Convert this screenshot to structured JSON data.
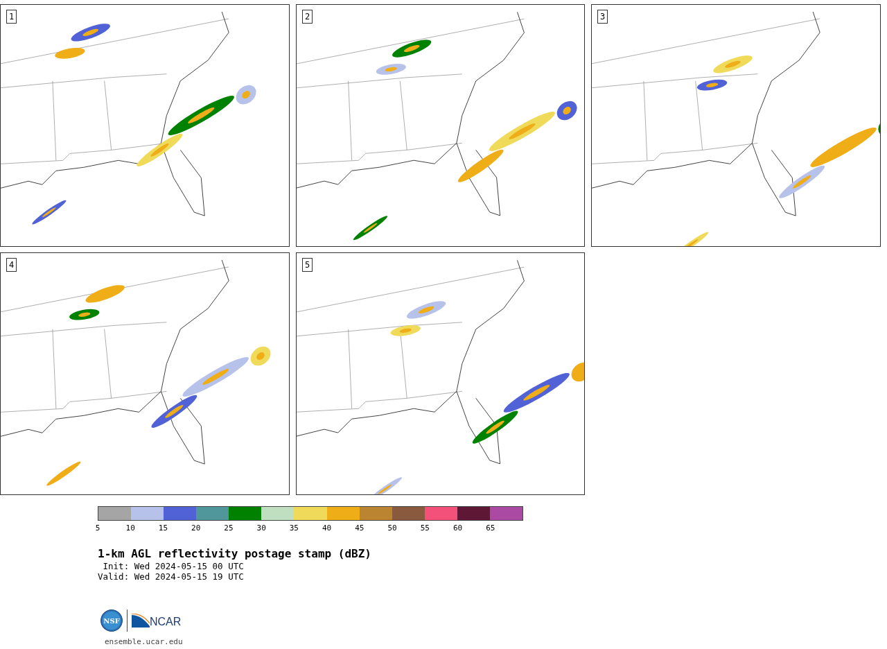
{
  "panels": [
    {
      "label": "1"
    },
    {
      "label": "2"
    },
    {
      "label": "3"
    },
    {
      "label": "4"
    },
    {
      "label": "5"
    }
  ],
  "colorbar": {
    "bins": [
      {
        "color": "#a5a5a5"
      },
      {
        "color": "#b7c2ea"
      },
      {
        "color": "#5062d5"
      },
      {
        "color": "#4f979b"
      },
      {
        "color": "#008100"
      },
      {
        "color": "#c0dfc0"
      },
      {
        "color": "#f0da5a"
      },
      {
        "color": "#efad17"
      },
      {
        "color": "#ba8430"
      },
      {
        "color": "#8a5a3e"
      },
      {
        "color": "#f4517a"
      },
      {
        "color": "#5e1735"
      },
      {
        "color": "#aa4aa2"
      }
    ],
    "ticks": [
      "5",
      "10",
      "15",
      "20",
      "25",
      "30",
      "35",
      "40",
      "45",
      "50",
      "55",
      "60",
      "65"
    ]
  },
  "title": "1-km AGL reflectivity postage stamp (dBZ)",
  "init": " Init: Wed 2024-05-15 00 UTC",
  "valid": "Valid: Wed 2024-05-15 19 UTC",
  "logos": {
    "nsf": "NSF",
    "ncar": "NCAR"
  },
  "url": "ensemble.ucar.edu"
}
